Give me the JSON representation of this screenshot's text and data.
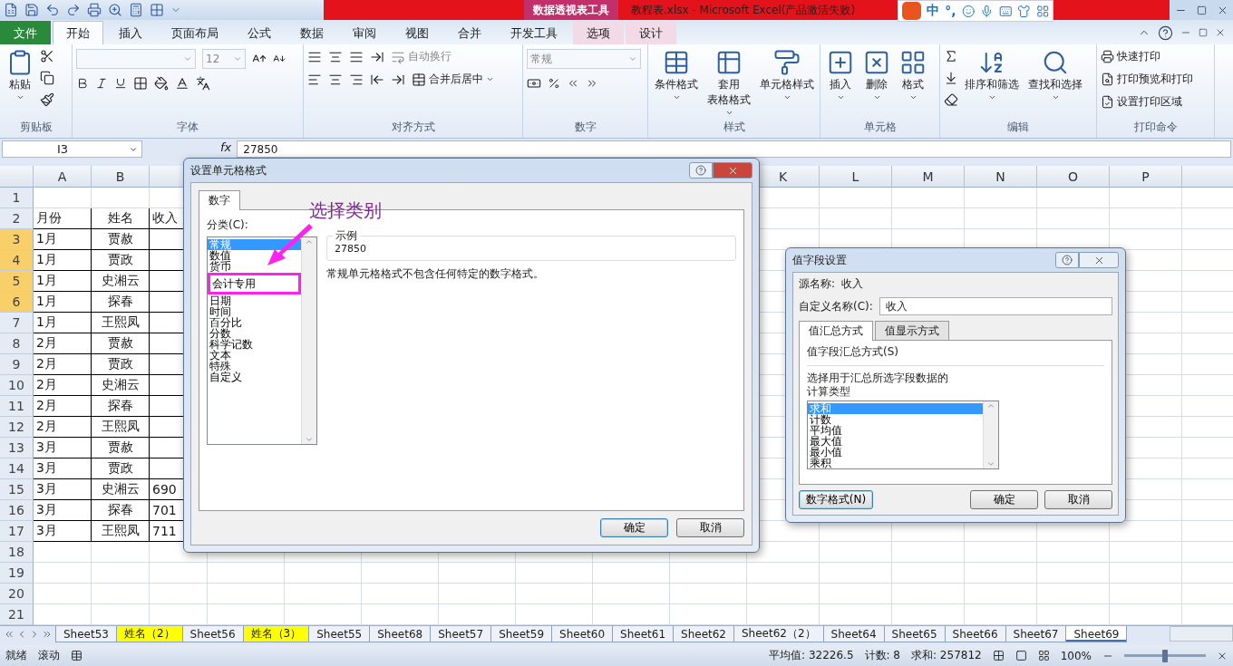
{
  "title_bar": {
    "contextual_label": "数据透视表工具",
    "title": "教程表.xlsx - Microsoft Excel(产品激活失败)",
    "ime_labels": [
      "中",
      "°,"
    ]
  },
  "ribbon_tabs": [
    {
      "label": "文件",
      "kind": "file",
      "selected": false
    },
    {
      "label": "开始",
      "kind": "normal",
      "selected": true
    },
    {
      "label": "插入",
      "kind": "normal",
      "selected": false
    },
    {
      "label": "页面布局",
      "kind": "normal",
      "selected": false
    },
    {
      "label": "公式",
      "kind": "normal",
      "selected": false
    },
    {
      "label": "数据",
      "kind": "normal",
      "selected": false
    },
    {
      "label": "审阅",
      "kind": "normal",
      "selected": false
    },
    {
      "label": "视图",
      "kind": "normal",
      "selected": false
    },
    {
      "label": "合并",
      "kind": "normal",
      "selected": false
    },
    {
      "label": "开发工具",
      "kind": "normal",
      "selected": false
    },
    {
      "label": "选项",
      "kind": "context",
      "selected": false
    },
    {
      "label": "设计",
      "kind": "context",
      "selected": false
    }
  ],
  "ribbon": {
    "clipboard": {
      "label": "剪贴板",
      "paste": "粘贴"
    },
    "font": {
      "label": "字体",
      "size": "12"
    },
    "alignment": {
      "label": "对齐方式",
      "wrap": "自动换行",
      "merge": "合并后居中"
    },
    "number": {
      "label": "数字",
      "format": "常规"
    },
    "styles": {
      "label": "样式",
      "buttons": [
        {
          "lines": [
            "条件格式"
          ]
        },
        {
          "lines": [
            "套用",
            "表格格式"
          ]
        },
        {
          "lines": [
            "单元格样式"
          ]
        }
      ]
    },
    "cells": {
      "label": "单元格",
      "buttons": [
        {
          "lines": [
            "插入"
          ]
        },
        {
          "lines": [
            "删除"
          ]
        },
        {
          "lines": [
            "格式"
          ]
        }
      ]
    },
    "editing": {
      "label": "编辑",
      "buttons": [
        {
          "lines": [
            "排序和筛选"
          ]
        },
        {
          "lines": [
            "查找和选择"
          ]
        }
      ]
    },
    "print": {
      "label": "打印命令",
      "items": [
        "快速打印",
        "打印预览和打印",
        "设置打印区域"
      ]
    }
  },
  "formula_bar": {
    "name_box": "I3",
    "fx": "fx",
    "value": "27850"
  },
  "sheet": {
    "columns_left": [
      "A",
      "B"
    ],
    "columns_right": [
      "K",
      "L",
      "M",
      "N",
      "O",
      "P"
    ],
    "rows": [
      {
        "number": "1",
        "selected": false
      },
      {
        "number": "2",
        "selected": false,
        "cells": [
          "月份",
          "姓名",
          "收入"
        ]
      },
      {
        "number": "3",
        "selected": true,
        "cells": [
          "1月",
          "贾赦"
        ]
      },
      {
        "number": "4",
        "selected": true,
        "cells": [
          "1月",
          "贾政"
        ]
      },
      {
        "number": "5",
        "selected": true,
        "cells": [
          "1月",
          "史湘云"
        ]
      },
      {
        "number": "6",
        "selected": true,
        "cells": [
          "1月",
          "探春"
        ]
      },
      {
        "number": "7",
        "selected": false,
        "cells": [
          "1月",
          "王熙凤"
        ]
      },
      {
        "number": "8",
        "selected": false,
        "cells": [
          "2月",
          "贾赦"
        ]
      },
      {
        "number": "9",
        "selected": false,
        "cells": [
          "2月",
          "贾政"
        ]
      },
      {
        "number": "10",
        "selected": false,
        "cells": [
          "2月",
          "史湘云"
        ]
      },
      {
        "number": "11",
        "selected": false,
        "cells": [
          "2月",
          "探春"
        ]
      },
      {
        "number": "12",
        "selected": false,
        "cells": [
          "2月",
          "王熙凤"
        ]
      },
      {
        "number": "13",
        "selected": false,
        "cells": [
          "3月",
          "贾赦"
        ]
      },
      {
        "number": "14",
        "selected": false,
        "cells": [
          "3月",
          "贾政"
        ]
      },
      {
        "number": "15",
        "selected": false,
        "cells": [
          "3月",
          "史湘云",
          "690"
        ]
      },
      {
        "number": "16",
        "selected": false,
        "cells": [
          "3月",
          "探春",
          "701"
        ]
      },
      {
        "number": "17",
        "selected": false,
        "cells": [
          "3月",
          "王熙凤",
          "711"
        ]
      },
      {
        "number": "18",
        "selected": false
      },
      {
        "number": "19",
        "selected": false
      },
      {
        "number": "20",
        "selected": false
      },
      {
        "number": "21",
        "selected": false
      }
    ]
  },
  "sheet_tabs": [
    {
      "label": "Sheet53",
      "selected": false
    },
    {
      "label": "姓名（2）",
      "selected": false,
      "color": "#ffff00"
    },
    {
      "label": "Sheet56",
      "selected": false
    },
    {
      "label": "姓名（3）",
      "selected": false,
      "color": "#ffff00"
    },
    {
      "label": "Sheet55",
      "selected": false
    },
    {
      "label": "Sheet68",
      "selected": false
    },
    {
      "label": "Sheet57",
      "selected": false
    },
    {
      "label": "Sheet59",
      "selected": false
    },
    {
      "label": "Sheet60",
      "selected": false
    },
    {
      "label": "Sheet61",
      "selected": false
    },
    {
      "label": "Sheet62",
      "selected": false
    },
    {
      "label": "Sheet62（2）",
      "selected": false
    },
    {
      "label": "Sheet64",
      "selected": false
    },
    {
      "label": "Sheet65",
      "selected": false
    },
    {
      "label": "Sheet66",
      "selected": false
    },
    {
      "label": "Sheet67",
      "selected": false
    },
    {
      "label": "Sheet69",
      "selected": true
    }
  ],
  "status": {
    "ready": "就绪",
    "scroll": "滚动",
    "average": "平均值: 32226.5",
    "count": "计数: 8",
    "sum": "求和: 257812",
    "zoom": "100%",
    "level": 0.5
  },
  "format_dialog": {
    "title": "设置单元格格式",
    "tab": "数字",
    "category_label": "分类(C):",
    "categories": [
      {
        "label": "常规",
        "selected": true
      },
      {
        "label": "数值",
        "selected": false
      },
      {
        "label": "货币",
        "selected": false
      },
      {
        "label": "会计专用",
        "selected": false,
        "highlighted": true
      },
      {
        "label": "日期",
        "selected": false
      },
      {
        "label": "时间",
        "selected": false
      },
      {
        "label": "百分比",
        "selected": false
      },
      {
        "label": "分数",
        "selected": false
      },
      {
        "label": "科学记数",
        "selected": false
      },
      {
        "label": "文本",
        "selected": false
      },
      {
        "label": "特殊",
        "selected": false
      },
      {
        "label": "自定义",
        "selected": false
      }
    ],
    "sample_label": "示例",
    "sample": "27850",
    "description": "常规单元格格式不包含任何特定的数字格式。",
    "ok": "确定",
    "cancel": "取消",
    "annotation": "选择类别"
  },
  "value_field_dialog": {
    "title": "值字段设置",
    "source_label": "源名称:",
    "source": "收入",
    "custom_label": "自定义名称(C):",
    "custom_value": "收入",
    "tabs": [
      {
        "label": "值汇总方式",
        "selected": true
      },
      {
        "label": "值显示方式",
        "selected": false
      }
    ],
    "group_label": "值字段汇总方式(S)",
    "description": "选择用于汇总所选字段数据的计算类型",
    "functions": [
      {
        "label": "求和",
        "selected": true
      },
      {
        "label": "计数",
        "selected": false
      },
      {
        "label": "平均值",
        "selected": false
      },
      {
        "label": "最大值",
        "selected": false
      },
      {
        "label": "最小值",
        "selected": false
      },
      {
        "label": "乘积",
        "selected": false
      }
    ],
    "number_format": "数字格式(N)",
    "ok": "确定",
    "cancel": "取消"
  }
}
